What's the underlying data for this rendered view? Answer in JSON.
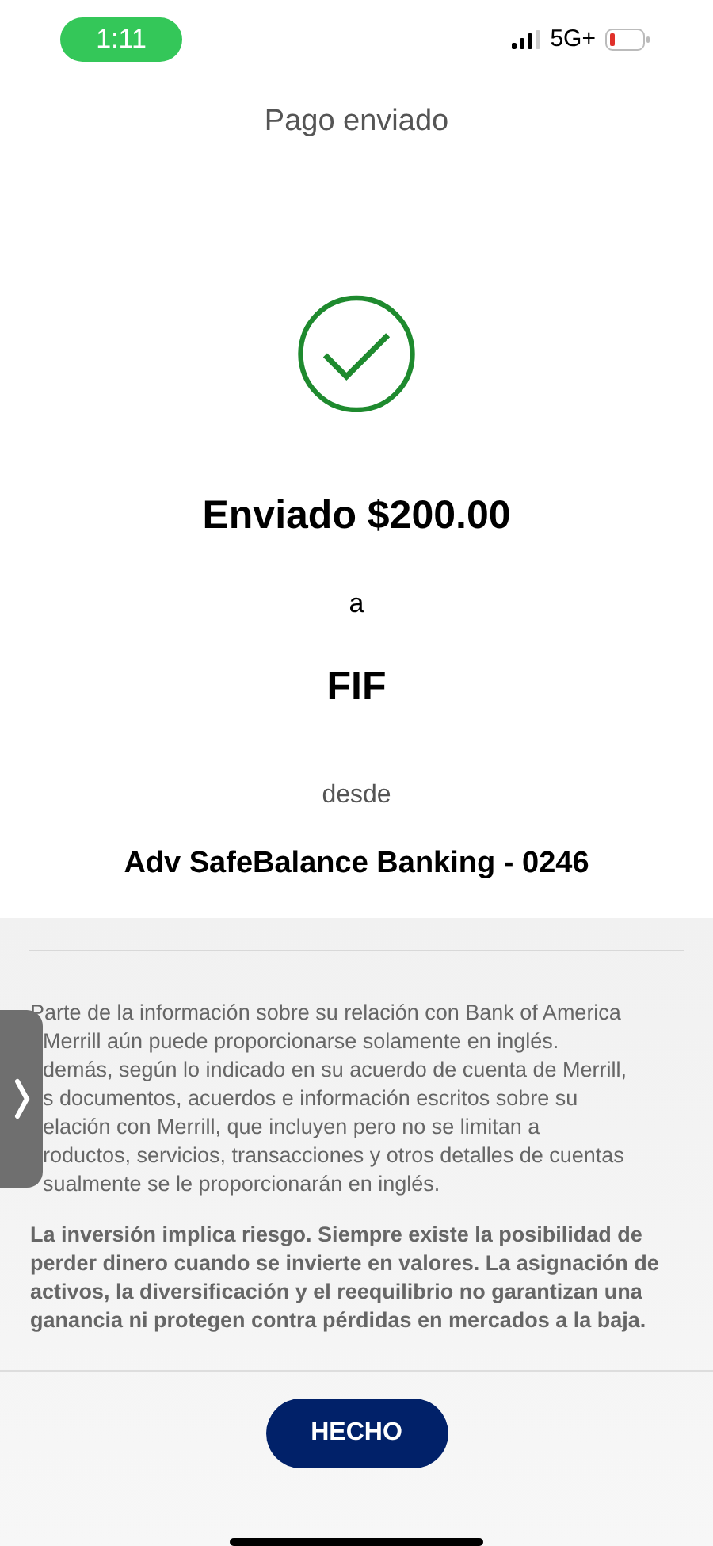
{
  "status_bar": {
    "time": "1:11",
    "network": "5G+"
  },
  "title": "Pago enviado",
  "amount": "Enviado $200.00",
  "to_label": "a",
  "recipient": "FIF",
  "from_label": "desde",
  "account": "Adv SafeBalance Banking - 0246",
  "disclosure_first_line": "Parte de la información sobre su relación con Bank of America",
  "disclosure_partly_hidden_lines": [
    "Merrill aún puede proporcionarse solamente en inglés.",
    "demás, según lo indicado en su acuerdo de cuenta de Merrill,",
    "s documentos, acuerdos e información escritos sobre su",
    "elación con Merrill, que incluyen pero no se limitan a",
    "roductos, servicios, transacciones y otros detalles de cuentas",
    "sualmente se le proporcionarán en inglés."
  ],
  "risk_notice": "La inversión implica riesgo. Siempre existe la posibilidad de perder dinero cuando se invierte en valores. La asignación de activos, la diversificación y el reequilibrio no garantizan una ganancia ni protegen contra pérdidas en mercados a la baja.",
  "done_button": "HECHO"
}
